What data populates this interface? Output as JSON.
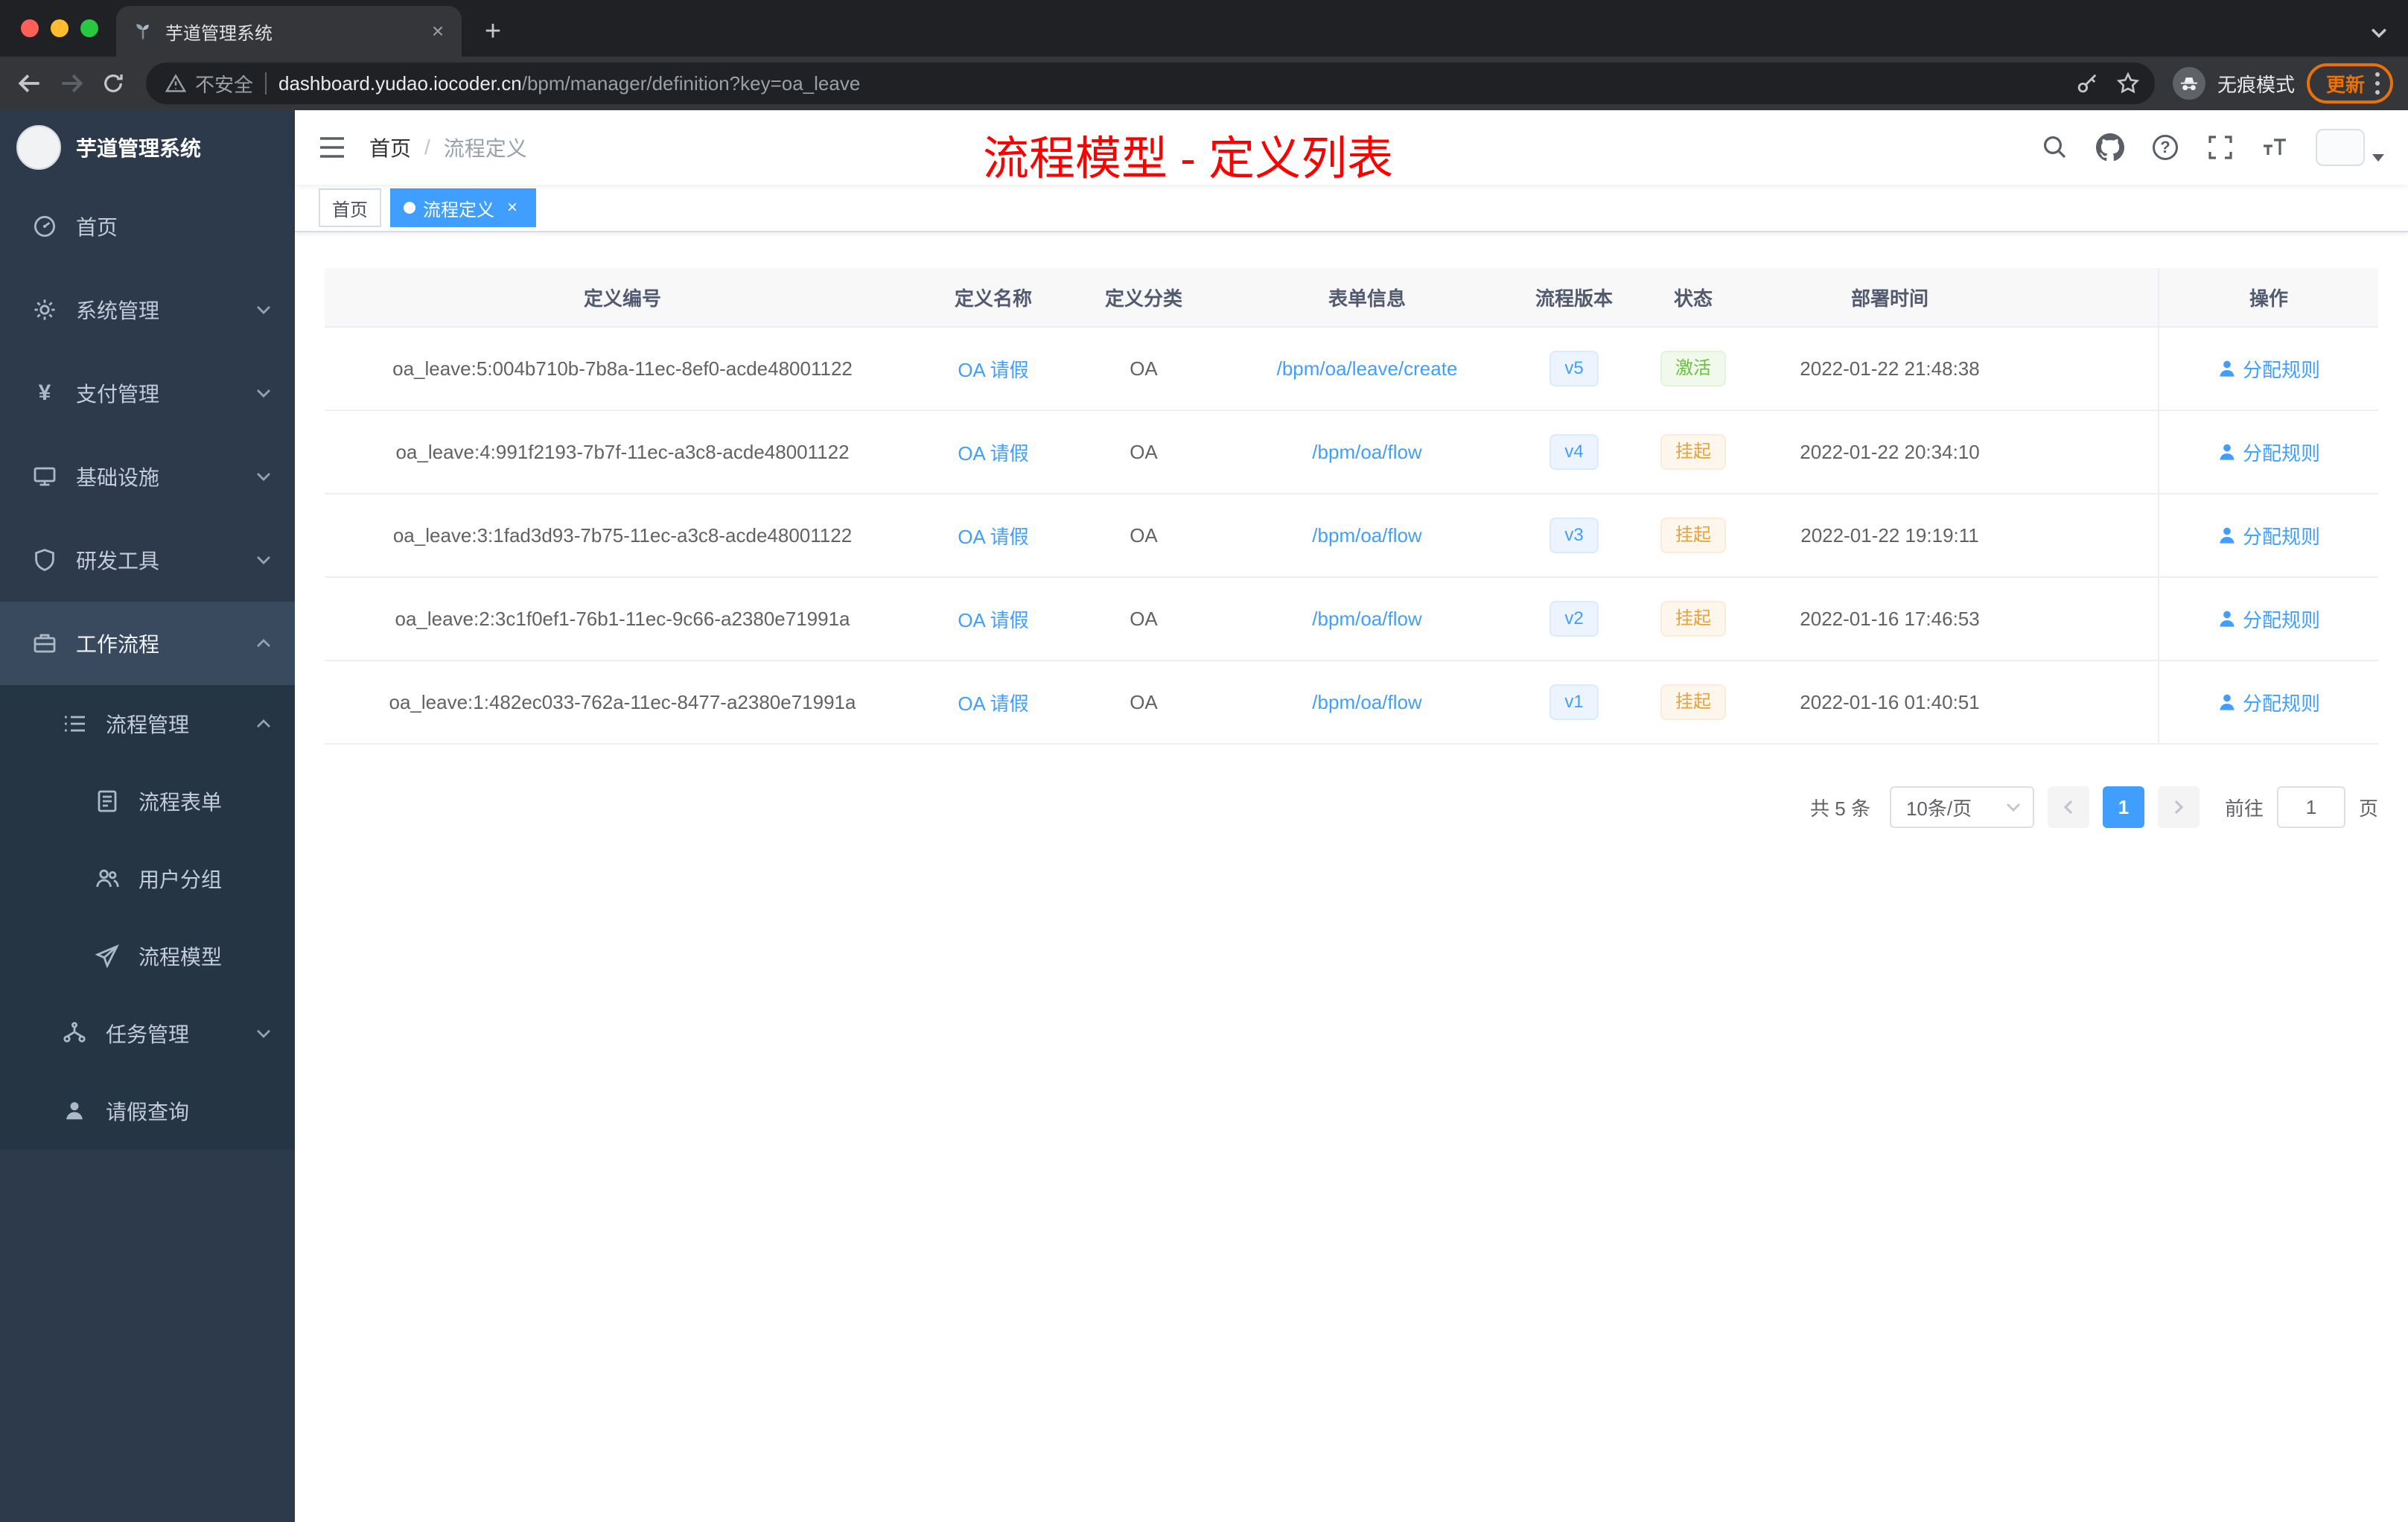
{
  "colors": {
    "accent": "#409eff",
    "success": "#67c23a",
    "warning": "#e6a23c",
    "annotation_red": "#ff0000",
    "sidebar_bg": "#2d3a4b",
    "update_orange": "#e8710a"
  },
  "glyphs": {
    "close": "×",
    "plus": "+",
    "question": "?",
    "yen": "¥"
  },
  "browser": {
    "tab_title": "芋道管理系统",
    "security_label": "不安全",
    "url_host": "dashboard.yudao.iocoder.cn",
    "url_path": "/bpm/manager/definition?key=oa_leave",
    "incognito_label": "无痕模式",
    "update_label": "更新"
  },
  "sidebar": {
    "brand": "芋道管理系统",
    "items": [
      {
        "label": "首页",
        "icon": "dashboard-icon"
      },
      {
        "label": "系统管理",
        "icon": "gear-icon"
      },
      {
        "label": "支付管理",
        "icon": "yen-icon"
      },
      {
        "label": "基础设施",
        "icon": "infrastructure-icon"
      },
      {
        "label": "研发工具",
        "icon": "tools-icon"
      },
      {
        "label": "工作流程",
        "icon": "workflow-icon"
      }
    ],
    "submenu": {
      "process_management": "流程管理",
      "process_form": "流程表单",
      "user_group": "用户分组",
      "process_model": "流程模型",
      "task_management": "任务管理",
      "leave_query": "请假查询"
    }
  },
  "navbar": {
    "breadcrumb_home": "首页",
    "breadcrumb_sep": "/",
    "breadcrumb_current": "流程定义",
    "icons": [
      "search-icon",
      "github-icon",
      "question-icon",
      "fullscreen-icon",
      "font-size-icon",
      "avatar",
      "caret-down-icon"
    ]
  },
  "annotation": "流程模型 - 定义列表",
  "tags": {
    "home": "首页",
    "current": "流程定义"
  },
  "table": {
    "columns": [
      "定义编号",
      "定义名称",
      "定义分类",
      "表单信息",
      "流程版本",
      "状态",
      "部署时间",
      "操作"
    ],
    "rows": [
      {
        "id": "oa_leave:5:004b710b-7b8a-11ec-8ef0-acde48001122",
        "name": "OA 请假",
        "category": "OA",
        "form": "/bpm/oa/leave/create",
        "version": "v5",
        "status": "激活",
        "time": "2022-01-22 21:48:38",
        "action": "分配规则"
      },
      {
        "id": "oa_leave:4:991f2193-7b7f-11ec-a3c8-acde48001122",
        "name": "OA 请假",
        "category": "OA",
        "form": "/bpm/oa/flow",
        "version": "v4",
        "status": "挂起",
        "time": "2022-01-22 20:34:10",
        "action": "分配规则"
      },
      {
        "id": "oa_leave:3:1fad3d93-7b75-11ec-a3c8-acde48001122",
        "name": "OA 请假",
        "category": "OA",
        "form": "/bpm/oa/flow",
        "version": "v3",
        "status": "挂起",
        "time": "2022-01-22 19:19:11",
        "action": "分配规则"
      },
      {
        "id": "oa_leave:2:3c1f0ef1-76b1-11ec-9c66-a2380e71991a",
        "name": "OA 请假",
        "category": "OA",
        "form": "/bpm/oa/flow",
        "version": "v2",
        "status": "挂起",
        "time": "2022-01-16 17:46:53",
        "action": "分配规则"
      },
      {
        "id": "oa_leave:1:482ec033-762a-11ec-8477-a2380e71991a",
        "name": "OA 请假",
        "category": "OA",
        "form": "/bpm/oa/flow",
        "version": "v1",
        "status": "挂起",
        "time": "2022-01-16 01:40:51",
        "action": "分配规则"
      }
    ]
  },
  "pagination": {
    "total": "共 5 条",
    "page_size": "10条/页",
    "current_page": "1",
    "goto_label": "前往",
    "goto_value": "1",
    "page_unit": "页"
  }
}
